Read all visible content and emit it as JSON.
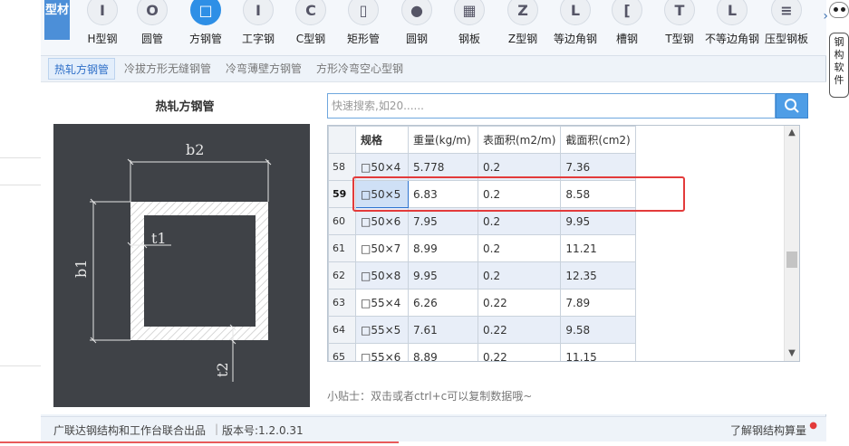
{
  "toolbar": {
    "category": "型材",
    "items": [
      {
        "glyph": "I",
        "label": "H型钢"
      },
      {
        "glyph": "O",
        "label": "圆管"
      },
      {
        "glyph": "□",
        "label": "方钢管"
      },
      {
        "glyph": "I",
        "label": "工字钢"
      },
      {
        "glyph": "C",
        "label": "C型钢"
      },
      {
        "glyph": "▯",
        "label": "矩形管"
      },
      {
        "glyph": "●",
        "label": "圆钢"
      },
      {
        "glyph": "▦",
        "label": "钢板"
      },
      {
        "glyph": "Z",
        "label": "Z型钢"
      },
      {
        "glyph": "L",
        "label": "等边角钢"
      },
      {
        "glyph": "[",
        "label": "槽钢"
      },
      {
        "glyph": "T",
        "label": "T型钢"
      },
      {
        "glyph": "L",
        "label": "不等边角钢"
      },
      {
        "glyph": "≡",
        "label": "压型钢板"
      }
    ],
    "active": "方钢管",
    "more": "›"
  },
  "subtabs": [
    "热轧方钢管",
    "冷拔方形无缝钢管",
    "冷弯薄壁方钢管",
    "方形冷弯空心型钢"
  ],
  "diagram": {
    "title": "热轧方钢管",
    "labels": {
      "b2": "b2",
      "b1": "b1",
      "t1": "t1",
      "t2": "t2"
    }
  },
  "search": {
    "placeholder": "快速搜索,如20......"
  },
  "table": {
    "headers": {
      "spec": "规格",
      "weight": "重量(kg/m)",
      "surface": "表面积(m2/m)",
      "section": "截面积(cm2)"
    },
    "rows": [
      {
        "num": "58",
        "spec": "□50×4",
        "weight": "5.778",
        "surface": "0.2",
        "section": "7.36"
      },
      {
        "num": "59",
        "spec": "□50×5",
        "weight": "6.83",
        "surface": "0.2",
        "section": "8.58"
      },
      {
        "num": "60",
        "spec": "□50×6",
        "weight": "7.95",
        "surface": "0.2",
        "section": "9.95"
      },
      {
        "num": "61",
        "spec": "□50×7",
        "weight": "8.99",
        "surface": "0.2",
        "section": "11.21"
      },
      {
        "num": "62",
        "spec": "□50×8",
        "weight": "9.95",
        "surface": "0.2",
        "section": "12.35"
      },
      {
        "num": "63",
        "spec": "□55×4",
        "weight": "6.26",
        "surface": "0.22",
        "section": "7.89"
      },
      {
        "num": "64",
        "spec": "□55×5",
        "weight": "7.61",
        "surface": "0.22",
        "section": "9.58"
      },
      {
        "num": "65",
        "spec": "□55×6",
        "weight": "8.89",
        "surface": "0.22",
        "section": "11.15"
      }
    ],
    "selected_row": "59"
  },
  "tip": "小贴士：双击或者ctrl+c可以复制数据哦~",
  "footer": {
    "credit": "广联达钢结构和工作台联合出品",
    "version": "版本号:1.2.0.31",
    "link": "了解钢结构算量"
  },
  "mascot": {
    "text": "钢构软件"
  },
  "colors": {
    "accent": "#2e8fe6",
    "highlight": "#e33b3b",
    "diagram_bg": "#3f4247"
  }
}
